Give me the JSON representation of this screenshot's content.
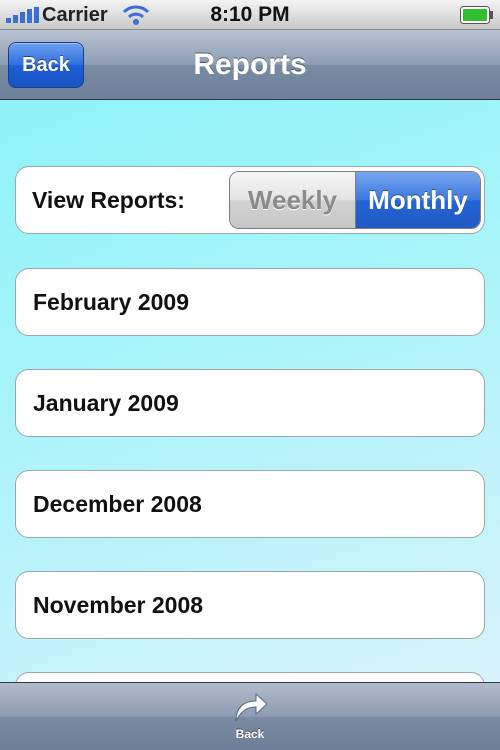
{
  "status_bar": {
    "carrier": "Carrier",
    "time": "8:10 PM",
    "icons": [
      "signal-bars-icon",
      "wifi-icon",
      "battery-icon"
    ]
  },
  "nav_bar": {
    "title": "Reports",
    "back_label": "Back"
  },
  "view_reports": {
    "label": "View Reports:",
    "segments": [
      "Weekly",
      "Monthly"
    ],
    "selected": "Monthly"
  },
  "reports": [
    {
      "label": "February 2009"
    },
    {
      "label": "January 2009"
    },
    {
      "label": "December 2008"
    },
    {
      "label": "November 2008"
    }
  ],
  "toolbar": {
    "back_label": "Back",
    "icon": "back-curved-arrow-icon"
  },
  "colors": {
    "accent": "#2464d5",
    "content_background": "#a7f4f9",
    "nav_bar": "#8d9db2"
  }
}
